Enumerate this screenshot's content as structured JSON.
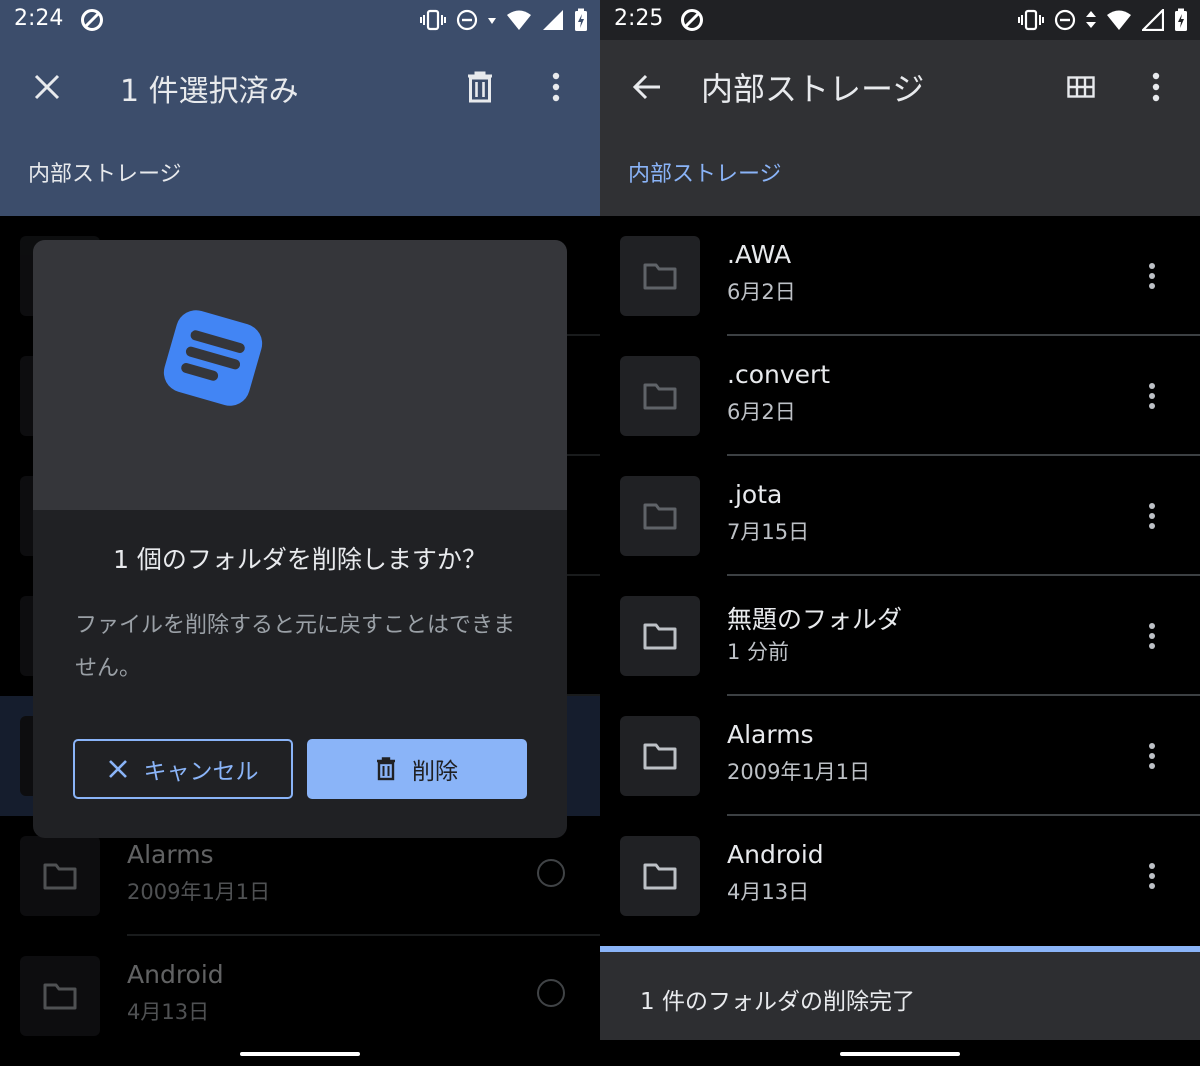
{
  "left": {
    "status_time": "2:24",
    "selection_title": "1 件選択済み",
    "breadcrumb": "内部ストレージ",
    "dialog": {
      "title": "1 個のフォルダを削除しますか？",
      "body": "ファイルを削除すると元に戻すことはできません。",
      "cancel_label": "キャンセル",
      "delete_label": "削除"
    },
    "rows": [
      {
        "name": "Alarms",
        "date": "2009年1月1日"
      },
      {
        "name": "Android",
        "date": "4月13日"
      }
    ]
  },
  "right": {
    "status_time": "2:25",
    "title": "内部ストレージ",
    "breadcrumb": "内部ストレージ",
    "rows": [
      {
        "name": ".AWA",
        "date": "6月2日"
      },
      {
        "name": ".convert",
        "date": "6月2日"
      },
      {
        "name": ".jota",
        "date": "7月15日"
      },
      {
        "name": "無題のフォルダ",
        "date": "1 分前"
      },
      {
        "name": "Alarms",
        "date": "2009年1月1日"
      },
      {
        "name": "Android",
        "date": "4月13日"
      }
    ],
    "snackbar": "1 件のフォルダの削除完了"
  },
  "colors": {
    "selection_bar": "#3c4d6b",
    "accent_blue": "#8ab4f8",
    "app_icon_blue": "#4285f4",
    "panel_dark": "#202124",
    "toolbar_dark": "#303134"
  },
  "icons": {
    "close": "close-icon",
    "trash": "trash-icon",
    "more": "more-vert-icon",
    "back": "arrow-back-icon",
    "grid": "grid-view-icon",
    "folder": "folder-icon"
  }
}
